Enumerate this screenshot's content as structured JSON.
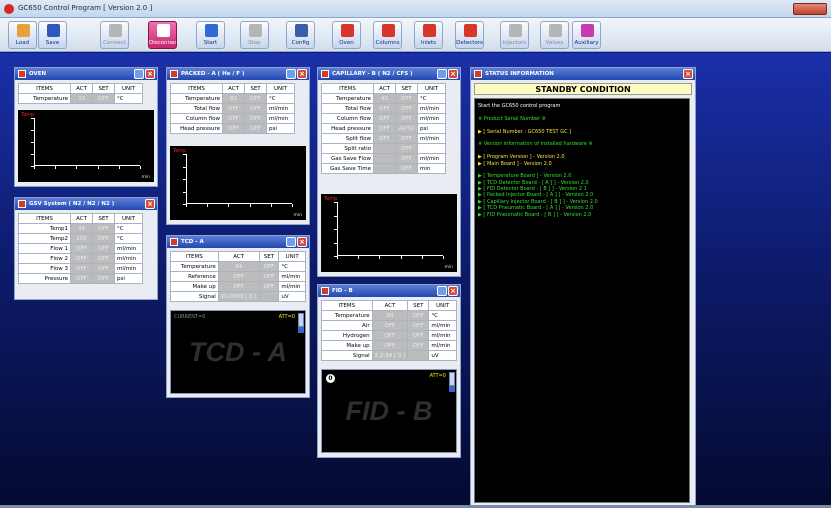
{
  "window": {
    "title": "GC650 Control Program [ Version 2.0 ]"
  },
  "toolbar": {
    "buttons": [
      {
        "label": "Load",
        "icon": "folder-icon",
        "color": "#e6a13a",
        "state": "normal"
      },
      {
        "label": "Save",
        "icon": "floppy-icon",
        "color": "#2e58b9",
        "state": "normal"
      },
      {
        "label": "Connect",
        "icon": "connect-icon",
        "color": "#b5b5b5",
        "state": "disabled"
      },
      {
        "label": "Disconnect",
        "icon": "disconnect-icon",
        "color": "#ffffff",
        "state": "active"
      },
      {
        "label": "Start",
        "icon": "play-icon",
        "color": "#2f6ad6",
        "state": "normal"
      },
      {
        "label": "Stop",
        "icon": "stop-icon",
        "color": "#b5b5b5",
        "state": "disabled"
      },
      {
        "label": "Config",
        "icon": "config-icon",
        "color": "#3a5fa8",
        "state": "normal"
      },
      {
        "label": "Oven",
        "icon": "oven-icon",
        "color": "#d8362a",
        "state": "normal"
      },
      {
        "label": "Columns",
        "icon": "columns-icon",
        "color": "#d8362a",
        "state": "normal"
      },
      {
        "label": "Inlets",
        "icon": "inlets-icon",
        "color": "#d8362a",
        "state": "normal"
      },
      {
        "label": "Detectors",
        "icon": "detectors-icon",
        "color": "#d8362a",
        "state": "normal"
      },
      {
        "label": "Injectors",
        "icon": "injectors-icon",
        "color": "#b5b5b5",
        "state": "disabled"
      },
      {
        "label": "Valves",
        "icon": "valves-icon",
        "color": "#b5b5b5",
        "state": "disabled"
      },
      {
        "label": "Auxiliary",
        "icon": "auxiliary-icon",
        "color": "#c83ab0",
        "state": "normal"
      }
    ]
  },
  "headers": {
    "items": "ITEMS",
    "act": "ACT",
    "set": "SET",
    "unit": "UNIT"
  },
  "oven": {
    "title": "OVEN",
    "rows": [
      {
        "name": "Temperature",
        "act": "33",
        "set": "OFF",
        "unit": "°C"
      }
    ]
  },
  "gsv": {
    "title": "GSV System ( N2 / N2 / N2 )",
    "rows": [
      {
        "name": "Temp1",
        "act": "34",
        "set": "OFF",
        "unit": "°C"
      },
      {
        "name": "Temp2",
        "act": "250",
        "set": "OFF",
        "unit": "°C"
      },
      {
        "name": "Flow 1",
        "act": "OFF",
        "set": "OFF",
        "unit": "ml/min"
      },
      {
        "name": "Flow 2",
        "act": "OFF",
        "set": "OFF",
        "unit": "ml/min"
      },
      {
        "name": "Flow 3",
        "act": "OFF",
        "set": "OFF",
        "unit": "ml/min"
      },
      {
        "name": "Pressure",
        "act": "OFF",
        "set": "OFF",
        "unit": "psi"
      }
    ]
  },
  "packed": {
    "title": "PACKED - A ( He / F )",
    "rows": [
      {
        "name": "Temperature",
        "act": "82",
        "set": "OFF",
        "unit": "°C"
      },
      {
        "name": "Total flow",
        "act": "OFF",
        "set": "OFF",
        "unit": "ml/min"
      },
      {
        "name": "Column flow",
        "act": "OFF",
        "set": "OFF",
        "unit": "ml/min"
      },
      {
        "name": "Head pressure",
        "act": "OFF",
        "set": "OFF",
        "unit": "psi"
      }
    ]
  },
  "tcd": {
    "title": "TCD - A",
    "rows": [
      {
        "name": "Temperature",
        "act": "84",
        "set": "OFF",
        "unit": "°C"
      },
      {
        "name": "Reference",
        "act": "OFF",
        "set": "OFF",
        "unit": "ml/min"
      },
      {
        "name": "Make up",
        "act": "OFF",
        "set": "OFF",
        "unit": "ml/min"
      },
      {
        "name": "Signal",
        "act": "10.0000 [ 0 ]",
        "set": "",
        "unit": "uV"
      }
    ],
    "current": "CURRENT=0",
    "att": "ATT=0",
    "watermark": "TCD - A"
  },
  "capillary": {
    "title": "CAPILLARY - B ( N2 / CFS )",
    "rows": [
      {
        "name": "Temperature",
        "act": "40",
        "set": "OFF",
        "unit": "°C"
      },
      {
        "name": "Total flow",
        "act": "OFF",
        "set": "OFF",
        "unit": "ml/min"
      },
      {
        "name": "Column flow",
        "act": "OFF",
        "set": "OFF",
        "unit": "ml/min"
      },
      {
        "name": "Head pressure",
        "act": "OFF",
        "set": "AUTO",
        "unit": "psi"
      },
      {
        "name": "Split flow",
        "act": "OFF",
        "set": "OFF",
        "unit": "ml/min"
      },
      {
        "name": "Split ratio",
        "act": "",
        "set": "OFF",
        "unit": ""
      },
      {
        "name": "Gas Save Flow",
        "act": "",
        "set": "OFF",
        "unit": "ml/min"
      },
      {
        "name": "Gas Save Time",
        "act": "",
        "set": "OFF",
        "unit": "min"
      }
    ]
  },
  "fid": {
    "title": "FID - B",
    "rows": [
      {
        "name": "Temperature",
        "act": "30",
        "set": "OFF",
        "unit": "°C"
      },
      {
        "name": "Air",
        "act": "OFF",
        "set": "OFF",
        "unit": "ml/min"
      },
      {
        "name": "Hydrogen",
        "act": "OFF",
        "set": "OFF",
        "unit": "ml/min"
      },
      {
        "name": "Make up",
        "act": "OFF",
        "set": "OFF",
        "unit": "ml/min"
      },
      {
        "name": "Signal",
        "act": "2.2.34 [ 0 ]",
        "set": "",
        "unit": "uV"
      }
    ],
    "flame_number": "0",
    "att": "ATT=0",
    "watermark": "FID - B"
  },
  "plots": {
    "ylabel": "Temp",
    "xlabel": "min"
  },
  "status": {
    "title": "STATUS INFORMATION",
    "condition": "STANDBY CONDITION",
    "lines": [
      {
        "text": "Start the GC650 control program",
        "color": "#ffffff"
      },
      {
        "text": "",
        "color": "#ffffff"
      },
      {
        "text": "※ Product Serial Number ※",
        "color": "#33e033"
      },
      {
        "text": "",
        "color": "#ffffff"
      },
      {
        "text": "▶ [ Serial Number : GC650 TEST GC ]",
        "color": "#f2e63c"
      },
      {
        "text": "",
        "color": "#ffffff"
      },
      {
        "text": "※ Version information of installed hardware ※",
        "color": "#33e033"
      },
      {
        "text": "",
        "color": "#ffffff"
      },
      {
        "text": "▶ [ Program Version ] - Version 2.0",
        "color": "#f2e63c"
      },
      {
        "text": "▶ [ Main Board ] - Version 2.0",
        "color": "#f2e63c"
      },
      {
        "text": "",
        "color": "#ffffff"
      },
      {
        "text": "▶ [ Temperature Board ] - Version 2.0",
        "color": "#33e033"
      },
      {
        "text": "▶ [ TCD Detector Board - [ A ] ] - Version 2.0",
        "color": "#33e033"
      },
      {
        "text": "▶ [ FID Detector Board - [ B ] ] - Version 2.1",
        "color": "#33e033"
      },
      {
        "text": "▶ [ Packed Injector Board - [ A ] ] - Version 2.0",
        "color": "#33e033"
      },
      {
        "text": "▶ [ Capillary Injector Board - [ B ] ] - Version 2.0",
        "color": "#33e033"
      },
      {
        "text": "▶ [ TCD Pneumatic Board - [ A ] ] - Version 2.0",
        "color": "#33e033"
      },
      {
        "text": "▶ [ FID Pneumatic Board - [ B ] ] - Version 2.0",
        "color": "#33e033"
      }
    ]
  }
}
